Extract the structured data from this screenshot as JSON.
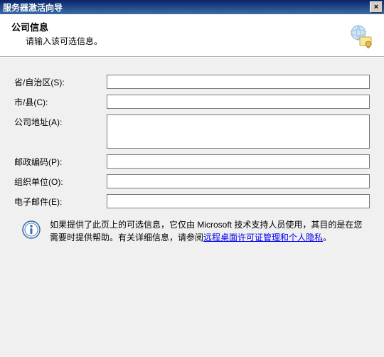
{
  "window": {
    "title": "服务器激活向导",
    "close_symbol": "×"
  },
  "header": {
    "title": "公司信息",
    "subtitle": "请输入该可选信息。"
  },
  "form": {
    "state_label": "省/自治区(S):",
    "city_label": "市/县(C):",
    "address_label": "公司地址(A):",
    "postal_label": "邮政编码(P):",
    "org_label": "组织单位(O):",
    "email_label": "电子邮件(E):",
    "state_value": "",
    "city_value": "",
    "address_value": "",
    "postal_value": "",
    "org_value": "",
    "email_value": ""
  },
  "info": {
    "text1": "如果提供了此页上的可选信息，它仅由 Microsoft 技术支持人员使用，其目的是在您需要时提供帮助。有关详细信息，请参阅",
    "link1": "远程桌面许可证管理和个人隐私",
    "text2": "。"
  }
}
